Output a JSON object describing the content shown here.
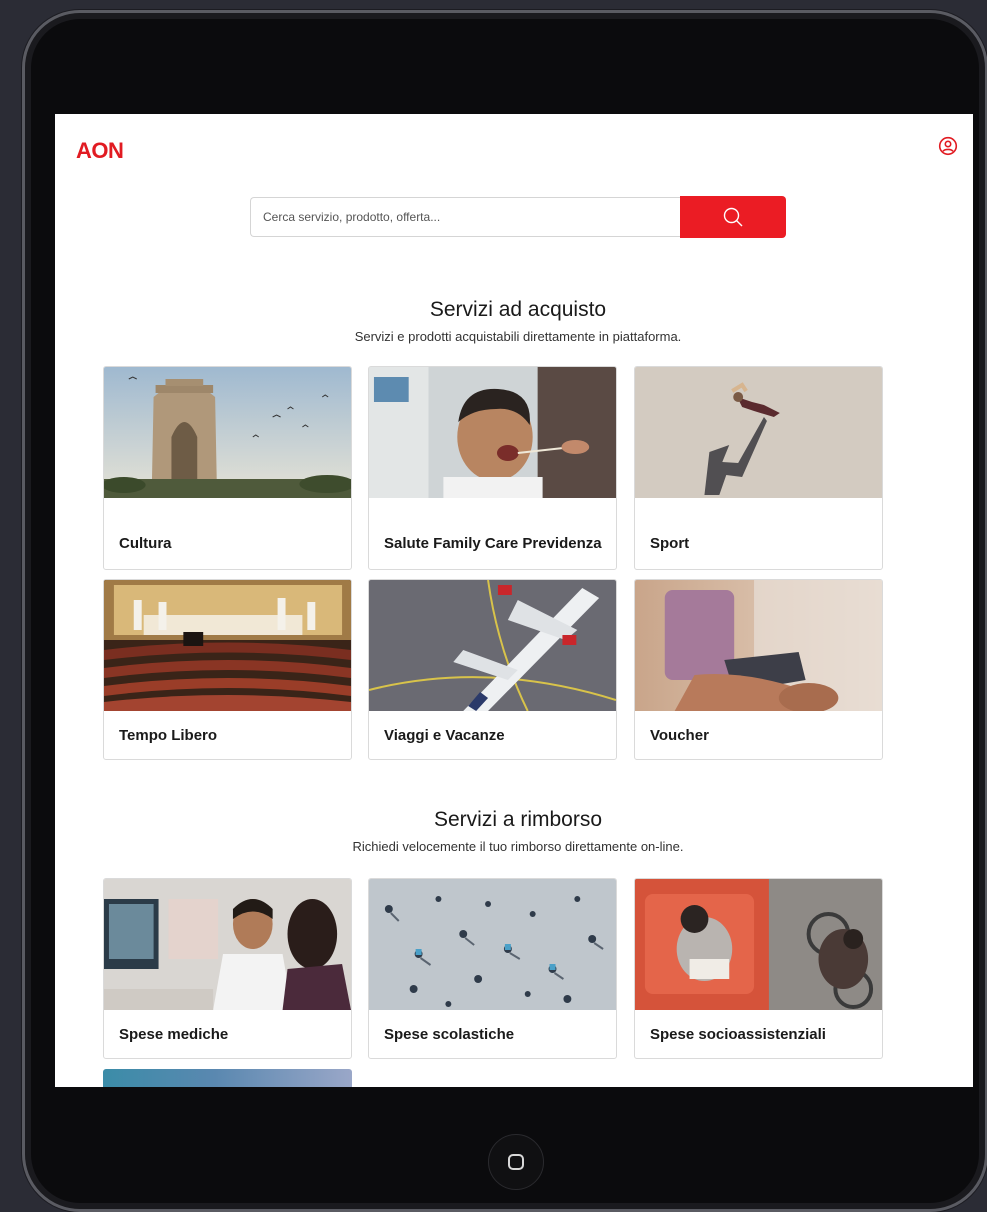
{
  "brand": {
    "logo_text": "AON",
    "accent_color": "#eb1c24"
  },
  "header": {
    "user_icon": "user-circle-icon"
  },
  "search": {
    "placeholder": "Cerca servizio, prodotto, offerta...",
    "button_icon": "search-icon"
  },
  "purchase_section": {
    "title": "Servizi ad acquisto",
    "subtitle": "Servizi e prodotti acquistabili direttamente in piattaforma.",
    "cards": [
      {
        "label": "Cultura",
        "image": "india-gate-photo"
      },
      {
        "label": "Salute Family Care Previdenza",
        "image": "child-throat-swab-photo"
      },
      {
        "label": "Sport",
        "image": "runner-shadow-photo"
      },
      {
        "label": "Tempo Libero",
        "image": "theater-stage-photo"
      },
      {
        "label": "Viaggi e Vacanze",
        "image": "airplane-aerial-photo"
      },
      {
        "label": "Voucher",
        "image": "phone-credit-card-photo"
      }
    ]
  },
  "refund_section": {
    "title": "Servizi a rimborso",
    "subtitle": "Richiedi velocemente il tuo rimborso direttamente on-line.",
    "cards": [
      {
        "label": "Spese mediche",
        "image": "doctor-patient-photo"
      },
      {
        "label": "Spese scolastiche",
        "image": "children-playground-aerial-photo"
      },
      {
        "label": "Spese socioassistenziali",
        "image": "wheelchair-aerial-photo"
      }
    ]
  },
  "device": {
    "home_button_icon": "home-square-icon"
  }
}
